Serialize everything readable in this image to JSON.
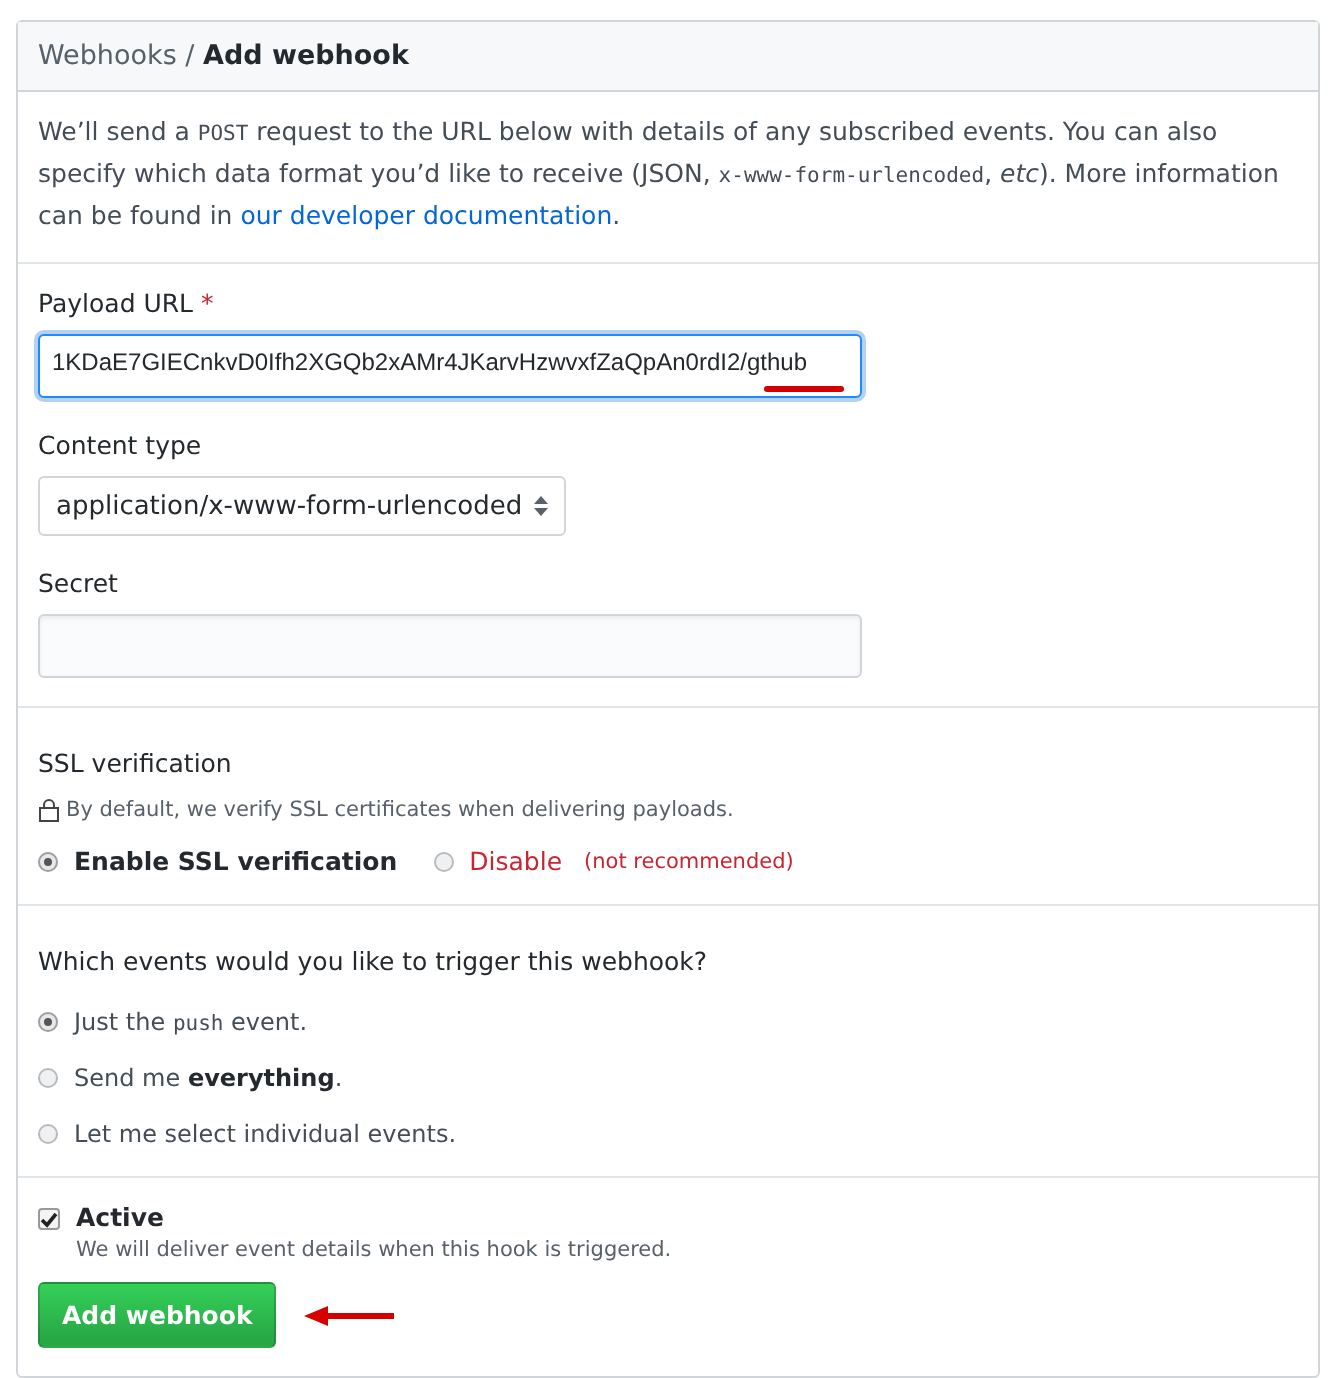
{
  "breadcrumb": {
    "parent": "Webhooks",
    "separator": "/",
    "current": "Add webhook"
  },
  "intro": [
    {
      "kind": "plain",
      "text": "We’ll send a "
    },
    {
      "kind": "code",
      "text": "POST"
    },
    {
      "kind": "plain",
      "text": " request to the URL below with details of any subscribed events. You can also specify which data format you’d like to receive (JSON, "
    },
    {
      "kind": "code",
      "text": "x-www-form-urlencoded"
    },
    {
      "kind": "plain",
      "text": ", "
    },
    {
      "kind": "italic",
      "text": "etc"
    },
    {
      "kind": "plain",
      "text": "). More information can be found in "
    },
    {
      "kind": "link",
      "text": "our developer documentation"
    },
    {
      "kind": "plain",
      "text": "."
    }
  ],
  "payload_url": {
    "label": "Payload URL",
    "required_mark": "*",
    "value": "1KDaE7GIECnkvD0Ifh2XGQb2xAMr4JKarvHzwvxfZaQpAn0rdI2/gthub",
    "focused": true,
    "end_underlined": true
  },
  "content_type": {
    "label": "Content type",
    "value": "application/x-www-form-urlencoded"
  },
  "secret": {
    "label": "Secret"
  },
  "ssl": {
    "title": "SSL verification",
    "note": "By default, we verify SSL certificates when delivering payloads.",
    "options": [
      {
        "kind": "normal",
        "label": "Enable SSL verification",
        "selected": true
      },
      {
        "kind": "danger",
        "label": "Disable",
        "hint": "(not recommended)",
        "selected": false
      }
    ]
  },
  "events": {
    "question": "Which events would you like to trigger this webhook?",
    "options": [
      {
        "selected": true,
        "label": [
          {
            "kind": "plain",
            "text": "Just the "
          },
          {
            "kind": "code",
            "text": "push"
          },
          {
            "kind": "plain",
            "text": " event."
          }
        ]
      },
      {
        "selected": false,
        "label": [
          {
            "kind": "plain",
            "text": "Send me "
          },
          {
            "kind": "bold",
            "text": "everything"
          },
          {
            "kind": "plain",
            "text": "."
          }
        ]
      },
      {
        "selected": false,
        "label": [
          {
            "kind": "plain",
            "text": "Let me select individual events."
          }
        ]
      }
    ]
  },
  "active": {
    "label": "Active",
    "note": "We will deliver event details when this hook is triggered.",
    "checked": true
  },
  "submit": {
    "label": "Add webhook",
    "arrow_marked": true
  }
}
